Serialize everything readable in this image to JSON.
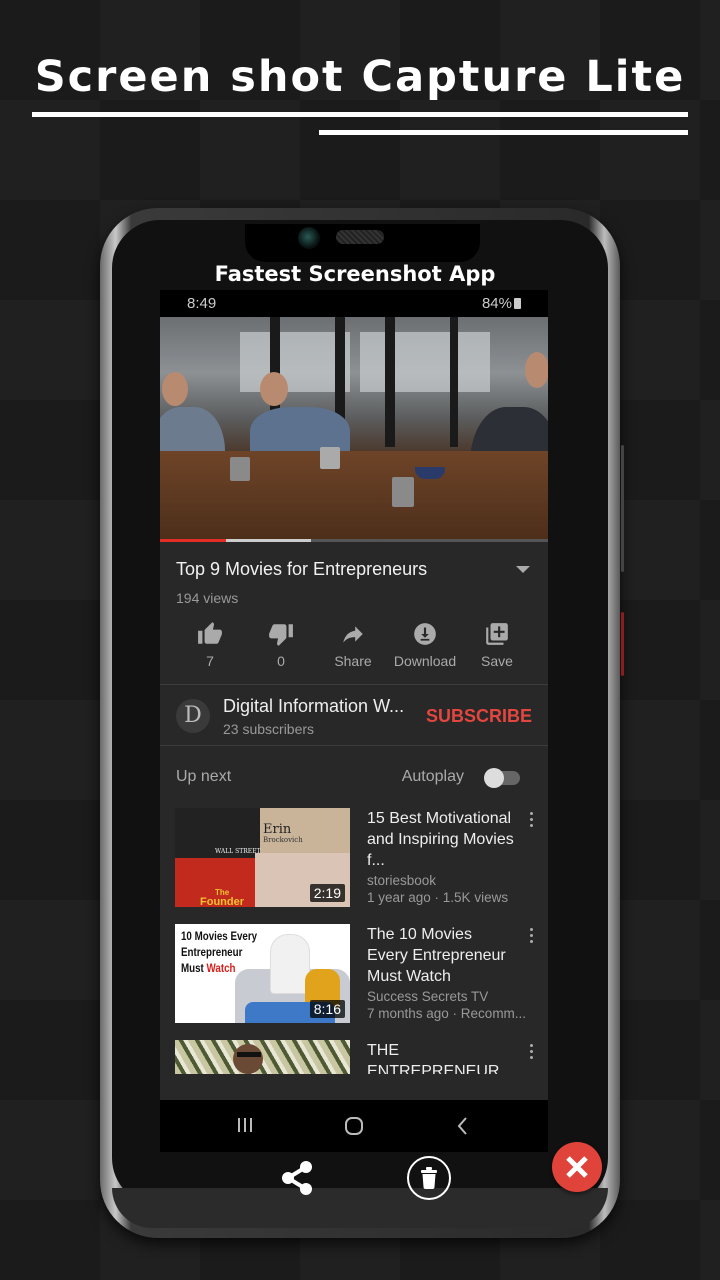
{
  "promo": {
    "headline": "Screen shot Capture Lite",
    "app_tagline": "Fastest Screenshot App"
  },
  "status_bar": {
    "time": "8:49",
    "battery": "84%"
  },
  "player": {
    "progress_played_fraction": 0.17,
    "progress_buffered_fraction": 0.39
  },
  "video": {
    "title": "Top 9 Movies for Entrepreneurs",
    "views": "194 views",
    "actions": [
      {
        "icon": "thumbs-up-icon",
        "label": "7"
      },
      {
        "icon": "thumbs-down-icon",
        "label": "0"
      },
      {
        "icon": "share-icon",
        "label": "Share"
      },
      {
        "icon": "download-icon",
        "label": "Download"
      },
      {
        "icon": "save-playlist-icon",
        "label": "Save"
      }
    ]
  },
  "channel": {
    "avatar_letter": "D",
    "name": "Digital Information W...",
    "subscribers": "23 subscribers",
    "subscribe_label": "SUBSCRIBE"
  },
  "up_next": {
    "label": "Up next",
    "autoplay_label": "Autoplay",
    "autoplay_on": false,
    "items": [
      {
        "title": "15 Best Motivational and Inspiring Movies f...",
        "channel": "storiesbook",
        "meta": "1 year ago · 1.5K views",
        "duration": "2:19",
        "thumb_texts": [
          "Erin",
          "Brockovich",
          "WALL STREET",
          "The",
          "Founder"
        ]
      },
      {
        "title": "The 10 Movies Every Entrepreneur Must Watch",
        "channel": "Success Secrets TV",
        "meta": "7 months ago · Recomm...",
        "duration": "8:16",
        "thumb_texts": [
          "10 Movies Every",
          "Entrepreneur",
          "Must ",
          "Watch"
        ]
      },
      {
        "title": "THE ENTREPRENEUR",
        "channel": "",
        "meta": "",
        "duration": ""
      }
    ]
  },
  "colors": {
    "accent_red": "#e2463f",
    "progress_red": "#e52d27",
    "close_button": "#e0433a"
  }
}
